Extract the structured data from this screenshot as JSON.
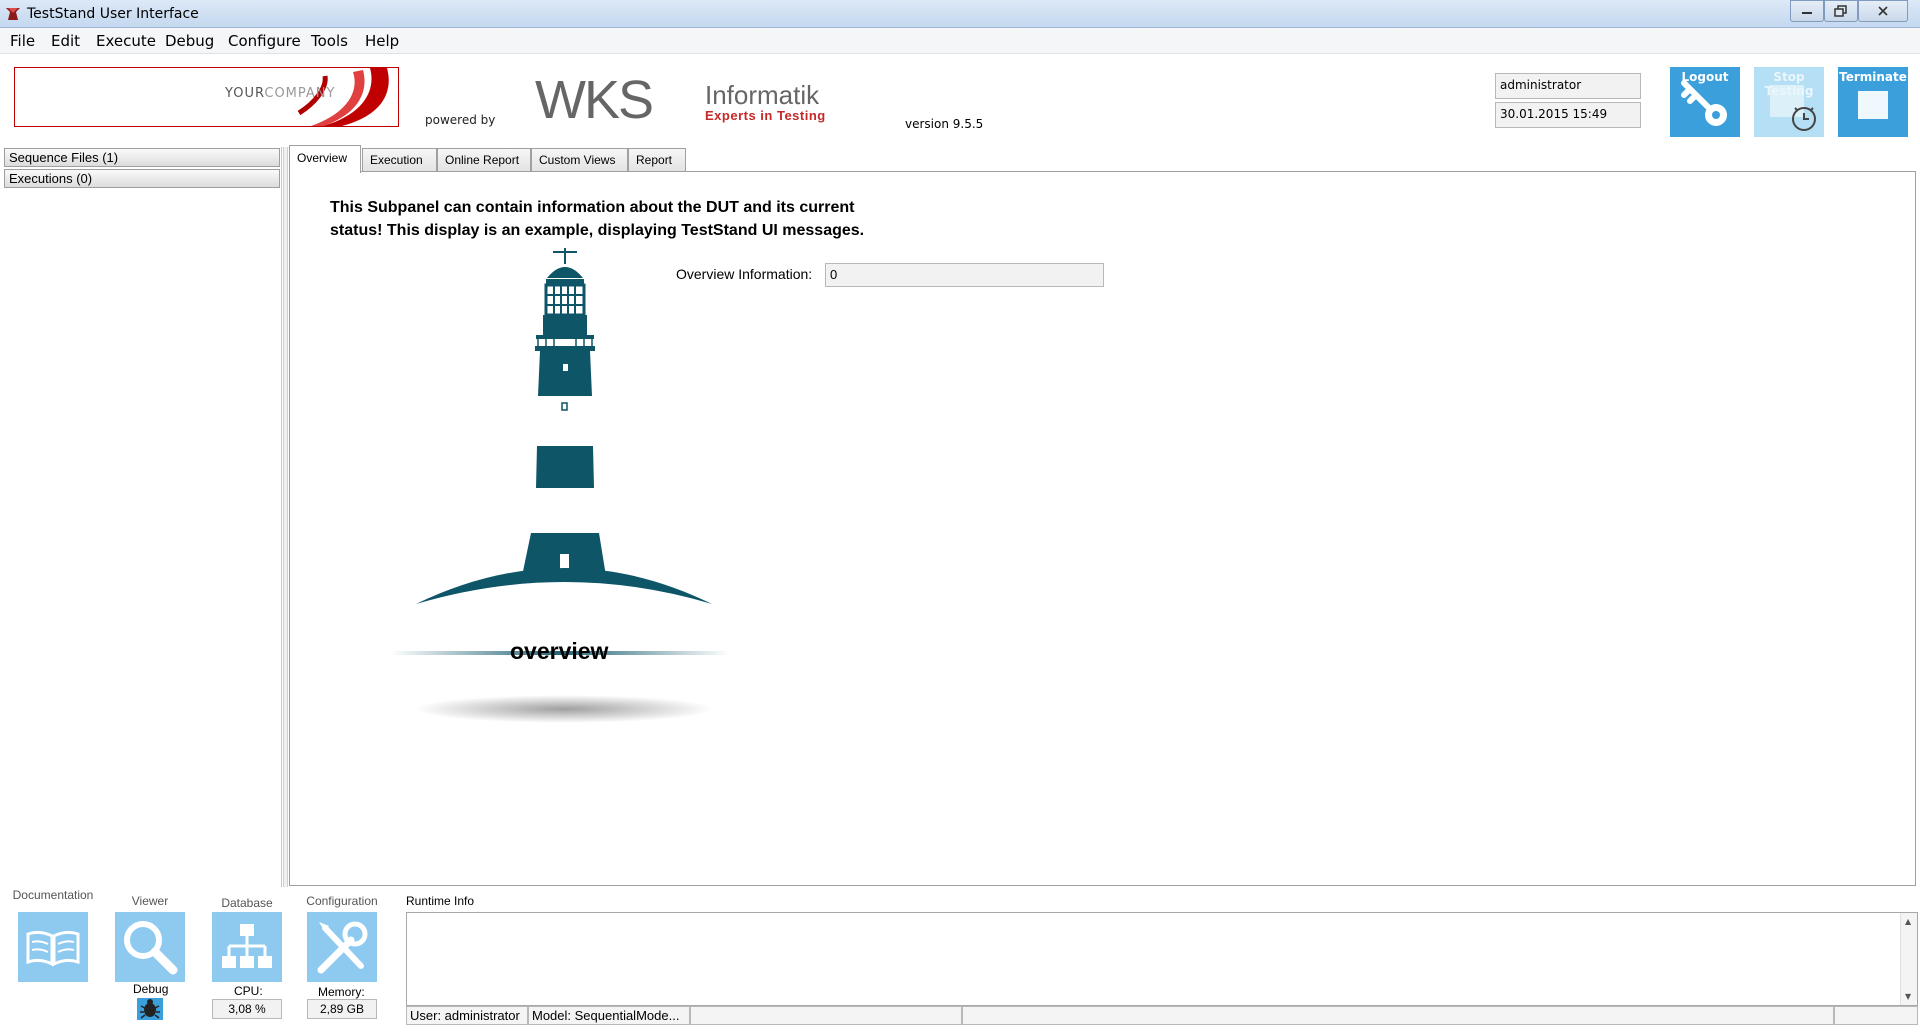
{
  "window": {
    "title": "TestStand User Interface"
  },
  "menu": [
    "File",
    "Edit",
    "Execute",
    "Debug",
    "Configure",
    "Tools",
    "Help"
  ],
  "header": {
    "company_logo_part1": "YOUR",
    "company_logo_part2": "COMPANY",
    "powered_by": "powered by",
    "wks": "WKS",
    "informatik": "Informatik",
    "experts": "Experts in Testing",
    "version": "version 9.5.5",
    "user": "administrator",
    "datetime": "30.01.2015 15:49",
    "logout_label": "Logout",
    "stop_label": "Stop Testing",
    "terminate_label": "Terminate"
  },
  "left_panel": {
    "sequence_files": "Sequence Files (1)",
    "executions": "Executions (0)"
  },
  "tabs": [
    {
      "label": "Overview",
      "active": true
    },
    {
      "label": "Execution",
      "active": false
    },
    {
      "label": "Online Report",
      "active": false
    },
    {
      "label": "Custom Views",
      "active": false
    },
    {
      "label": "Report",
      "active": false
    }
  ],
  "overview": {
    "message": "This Subpanel can contain information about the DUT and its current status! This display is an example, displaying TestStand UI messages.",
    "info_label": "Overview Information:",
    "info_value": "0",
    "caption": "overview"
  },
  "tools": {
    "documentation": "Documentation",
    "viewer": "Viewer",
    "debug": "Debug",
    "database": "Database",
    "cpu_label": "CPU:",
    "cpu_value": "3,08 %",
    "configuration": "Configuration",
    "memory_label": "Memory:",
    "memory_value": "2,89 GB"
  },
  "runtime": {
    "label": "Runtime Info"
  },
  "status": {
    "user": "User: administrator",
    "model": "Model: SequentialMode..."
  },
  "colors": {
    "accent_blue": "#3b9fdc",
    "light_blue": "#8ec9ef",
    "lighthouse": "#0e5568",
    "logo_red": "#c00000"
  }
}
